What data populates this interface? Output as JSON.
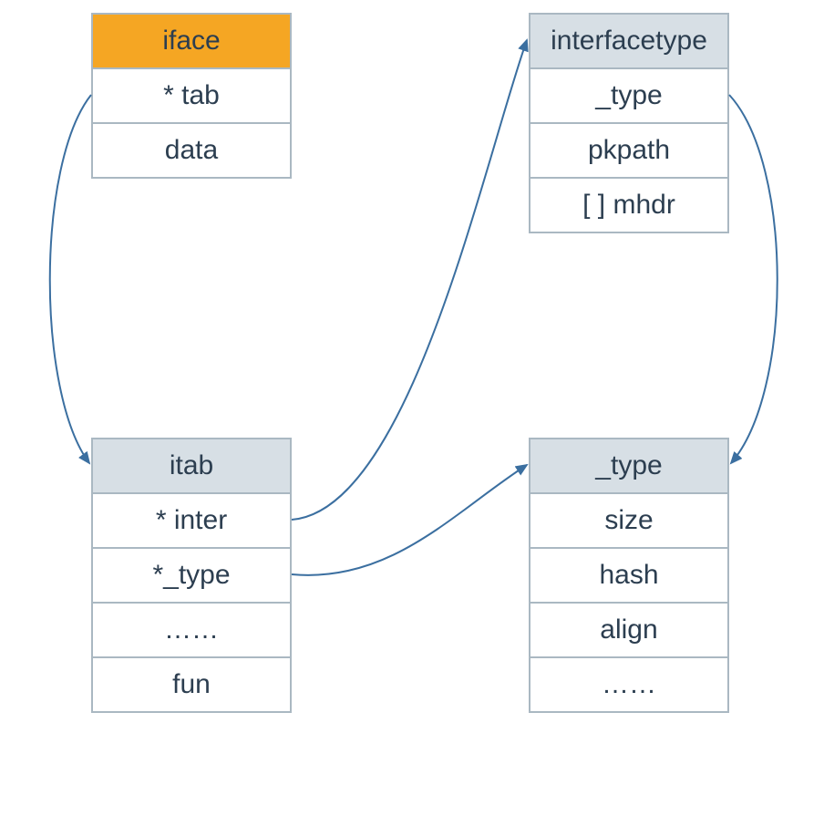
{
  "boxes": {
    "iface": {
      "title": "iface",
      "fields": [
        "* tab",
        "data"
      ]
    },
    "interfacetype": {
      "title": "interfacetype",
      "fields": [
        "_type",
        "pkpath",
        "[ ] mhdr"
      ]
    },
    "itab": {
      "title": "itab",
      "fields": [
        "* inter",
        "*_type",
        "……",
        "fun"
      ]
    },
    "type": {
      "title": "_type",
      "fields": [
        "size",
        "hash",
        "align",
        "……"
      ]
    }
  },
  "colors": {
    "highlight": "#f5a623",
    "headerBg": "#d7dfe5",
    "border": "#aab8c2",
    "text": "#2c3e50",
    "arrow": "#3b6fa0"
  }
}
